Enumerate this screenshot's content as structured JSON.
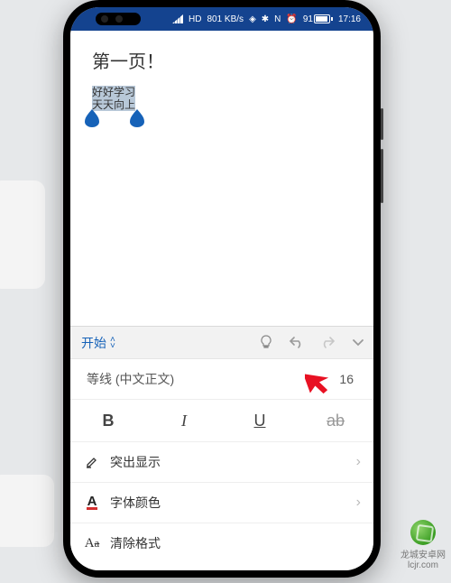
{
  "status": {
    "hd": "HD",
    "net": "801 KB/s",
    "nfc": "N",
    "bt": "✱",
    "battery_pct": "91",
    "time": "17:16"
  },
  "document": {
    "title": "第一页！",
    "selected_text": "好好学习\n天天向上"
  },
  "toolbar": {
    "tab_label": "开始"
  },
  "panel": {
    "font_name": "等线 (中文正文)",
    "font_size": "16",
    "bold": "B",
    "italic": "I",
    "underline": "U",
    "strike": "ab",
    "highlight_label": "突出显示",
    "fontcolor_label": "字体颜色",
    "fontcolor_icon": "A",
    "clear_label": "清除格式",
    "clear_icon": "A",
    "clear_icon_sub": "a"
  },
  "watermark": {
    "line1": "龙城安卓网",
    "line2": "lcjr.com"
  }
}
